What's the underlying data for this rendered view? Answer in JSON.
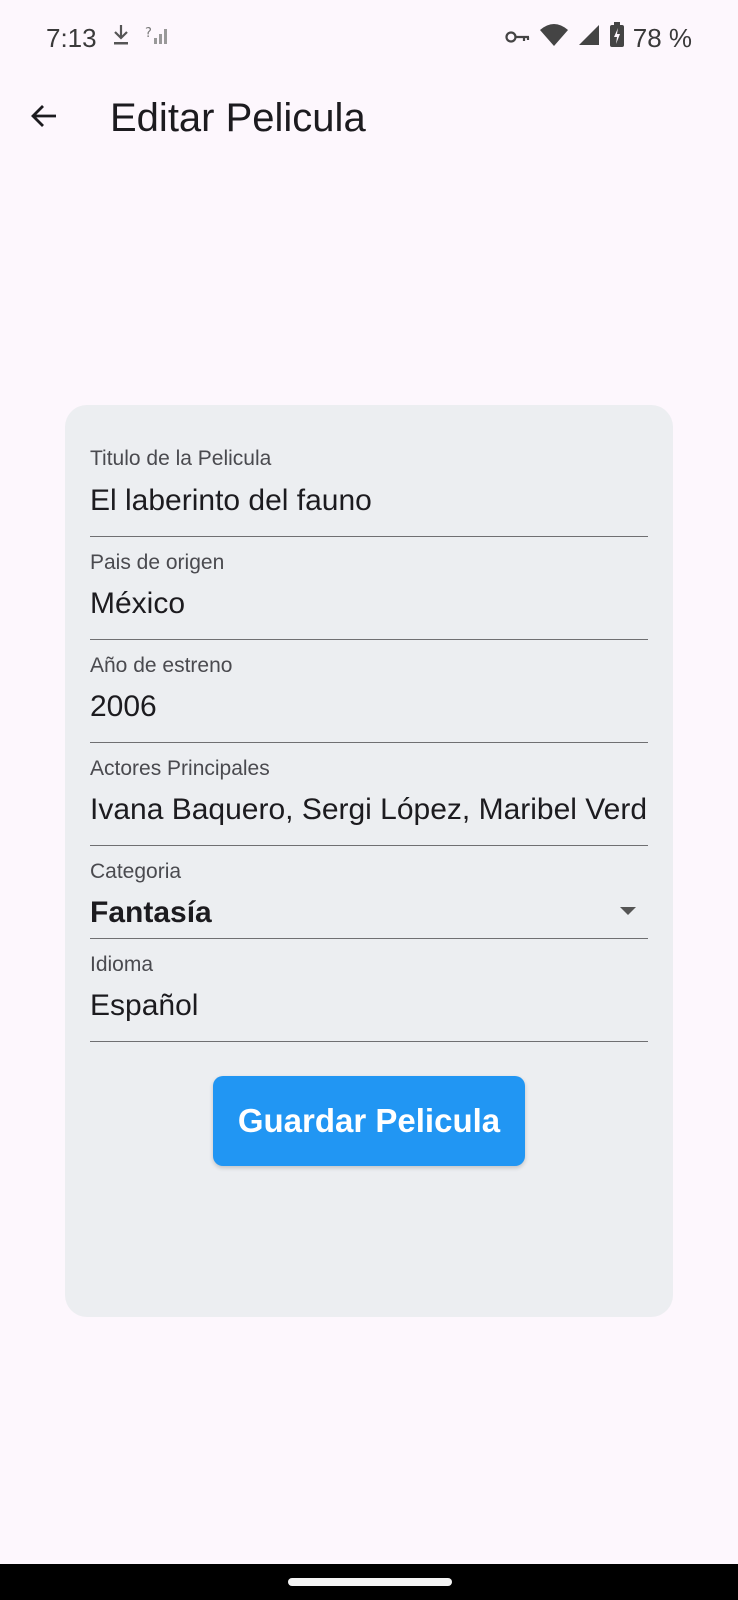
{
  "status_bar": {
    "time": "7:13",
    "battery": "78 %",
    "icons": [
      "download-icon",
      "no-signal-icon",
      "vpn-key-icon",
      "wifi-icon",
      "cell-signal-icon",
      "battery-charging-icon"
    ]
  },
  "app_bar": {
    "title": "Editar Pelicula",
    "back_icon": "arrow-back-icon"
  },
  "form": {
    "titulo": {
      "label": "Titulo de la Pelicula",
      "value": "El laberinto del fauno"
    },
    "pais": {
      "label": "Pais de origen",
      "value": "México"
    },
    "anio": {
      "label": "Año de estreno",
      "value": "2006"
    },
    "actores": {
      "label": "Actores Principales",
      "value": "Ivana Baquero, Sergi López, Maribel Verdú"
    },
    "categoria": {
      "label": "Categoria",
      "value": "Fantasía"
    },
    "idioma": {
      "label": "Idioma",
      "value": "Español"
    }
  },
  "save_button": {
    "label": "Guardar Pelicula"
  },
  "colors": {
    "background": "#fdf7fd",
    "card": "#eceef1",
    "primary_button": "#2196f3"
  }
}
